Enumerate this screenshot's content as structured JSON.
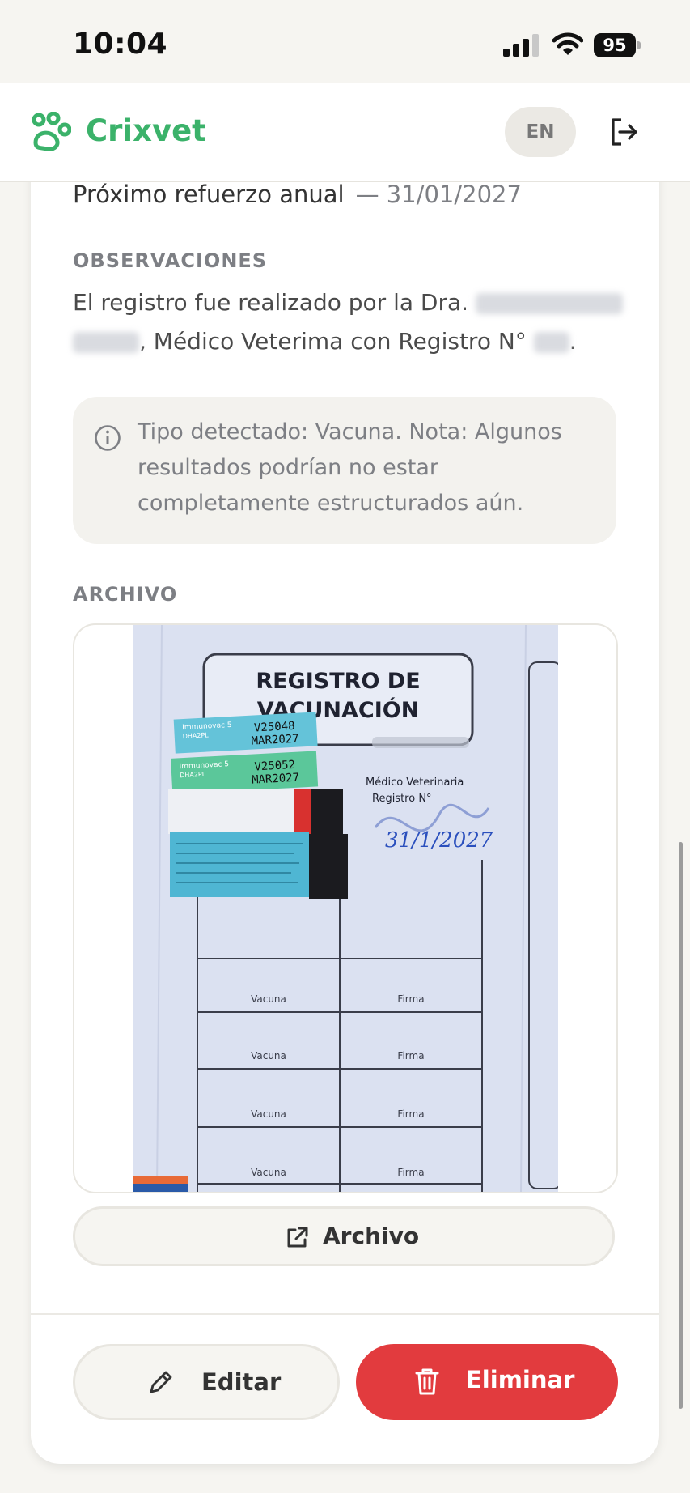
{
  "status_bar": {
    "time": "10:04",
    "battery": "95"
  },
  "header": {
    "brand": "Crixvet",
    "language": "EN"
  },
  "record": {
    "booster_label": "Próximo refuerzo anual",
    "booster_date": "— 31/01/2027",
    "observations_heading": "OBSERVACIONES",
    "observations_part1": "El registro fue realizado por la Dra.",
    "observations_part2": ", Médico Veterima con Registro N°",
    "observations_end": ".",
    "info_note": "Tipo detectado: Vacuna. Nota: Algunos resultados podrían no estar completamente estructurados aún.",
    "file_heading": "ARCHIVO",
    "file_button": "Archivo"
  },
  "document_image": {
    "title_line1": "REGISTRO DE",
    "title_line2": "VACUNACIÓN",
    "sticker1_brand": "Immunovac 5",
    "sticker1_type": "DHA2PL",
    "sticker1_lot": "V25048",
    "sticker1_exp": "MAR2027",
    "sticker2_brand": "Immunovac 5",
    "sticker2_type": "DHA2PL",
    "sticker2_lot": "V25052",
    "sticker2_exp": "MAR2027",
    "vet_title": "Médico Veterinaria",
    "registry": "Registro N°",
    "handwritten_date": "31/1/2027",
    "column_vaccine": "Vacuna",
    "column_signature": "Firma"
  },
  "actions": {
    "edit": "Editar",
    "delete": "Eliminar"
  },
  "colors": {
    "brand": "#3bb26a",
    "danger": "#e23b3e",
    "background": "#f6f5f1"
  },
  "icons": [
    "signal-icon",
    "wifi-icon",
    "battery-icon",
    "paw-logo-icon",
    "logout-icon",
    "info-icon",
    "external-link-icon",
    "pencil-icon",
    "trash-icon"
  ]
}
